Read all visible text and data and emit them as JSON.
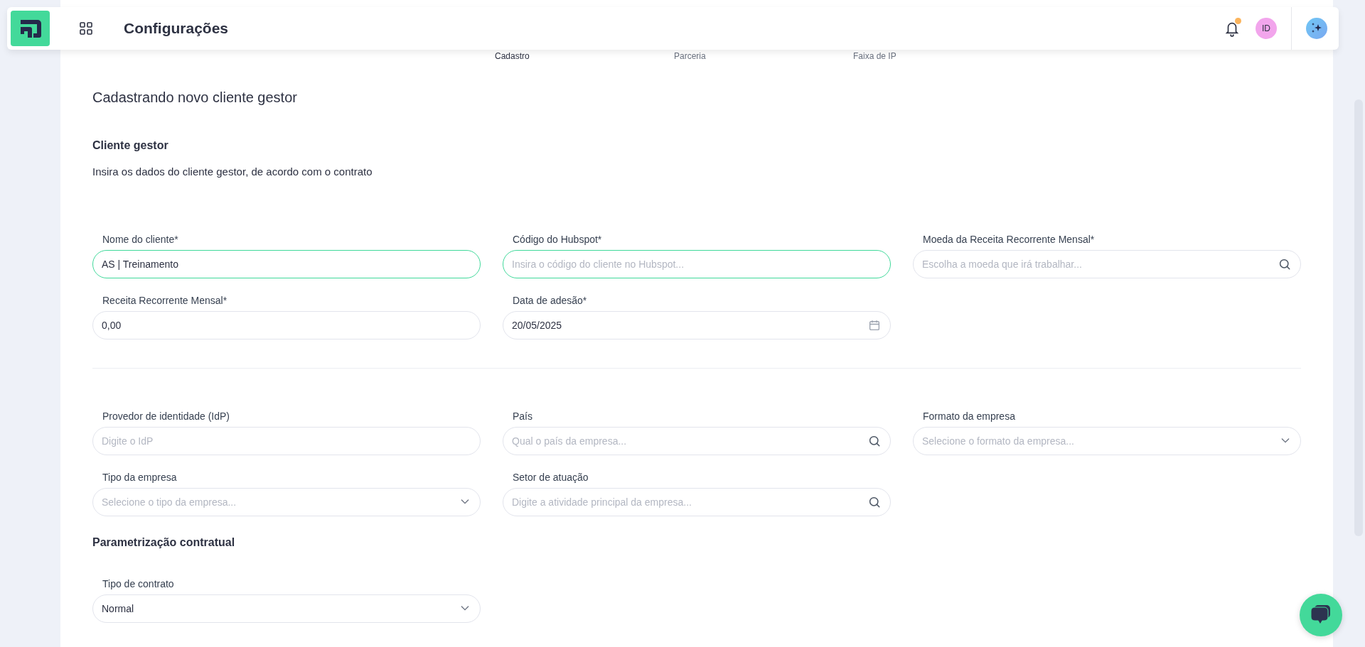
{
  "header": {
    "title": "Configurações",
    "notification_dot": true,
    "avatar": "ID"
  },
  "steps": [
    {
      "label": "Cadastro",
      "selected": true
    },
    {
      "label": "Parceria",
      "selected": false
    },
    {
      "label": "Faixa de IP",
      "selected": false
    }
  ],
  "page_title": "Cadastrando novo cliente gestor",
  "sections": [
    {
      "title": "Cliente gestor",
      "description": "Insira os dados do cliente gestor, de acordo com o contrato",
      "divider_after": true,
      "rows": [
        [
          {
            "label": "Nome do cliente*",
            "kind": "text",
            "value": "AS | Treinamento",
            "focused": true
          },
          {
            "label": "Código do Hubspot*",
            "kind": "text",
            "placeholder": "Insira o código do cliente no Hubspot...",
            "focused": true
          },
          {
            "label": "Moeda da Receita Recorrente Mensal*",
            "kind": "search",
            "placeholder": "Escolha a moeda que irá trabalhar...",
            "focused": false
          }
        ],
        [
          {
            "label": "Receita Recorrente Mensal*",
            "kind": "text",
            "value": "0,00",
            "focused": false
          },
          {
            "label": "Data de adesão*",
            "kind": "date",
            "value": "20/05/2025",
            "focused": false
          }
        ]
      ]
    },
    {
      "divider_after": false,
      "rows": [
        [
          {
            "label": "Provedor de identidade (IdP)",
            "kind": "text",
            "placeholder": "Digite o IdP",
            "focused": false
          },
          {
            "label": "País",
            "kind": "search",
            "placeholder": "Qual o país da empresa...",
            "focused": false
          },
          {
            "label": "Formato da empresa",
            "kind": "select",
            "placeholder": "Selecione o formato da empresa...",
            "focused": false
          }
        ],
        [
          {
            "label": "Tipo da empresa",
            "kind": "select",
            "placeholder": "Selecione o tipo da empresa...",
            "focused": false
          },
          {
            "label": "Setor de atuação",
            "kind": "search",
            "placeholder": "Digite a atividade principal da empresa...",
            "focused": false
          }
        ]
      ]
    },
    {
      "title": "Parametrização contratual",
      "divider_after": false,
      "rows": [
        [
          {
            "label": "Tipo de contrato",
            "kind": "select",
            "value": "Normal",
            "focused": false
          }
        ]
      ]
    }
  ]
}
